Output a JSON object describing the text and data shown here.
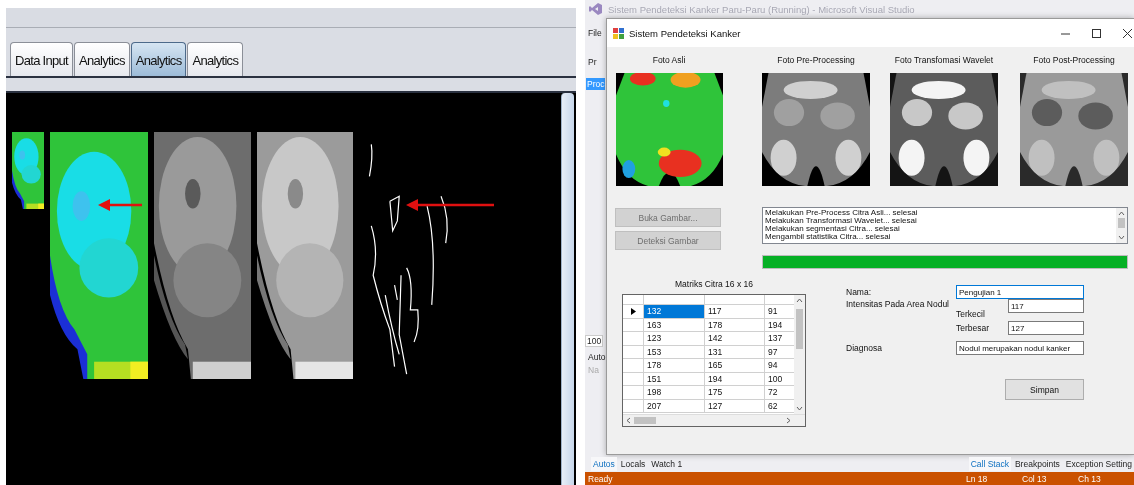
{
  "left_app": {
    "tabs": [
      {
        "label": "Data Input",
        "selected": false
      },
      {
        "label": "Analytics",
        "selected": false
      },
      {
        "label": "Analytics",
        "selected": true
      },
      {
        "label": "Analytics",
        "selected": false
      }
    ]
  },
  "ide": {
    "title": "Sistem Pendeteksi Kanker Paru-Paru (Running) - Microsoft Visual Studio",
    "side_fragments": [
      {
        "text": "File",
        "kind": "menu"
      },
      {
        "text": "Pr",
        "kind": "text"
      },
      {
        "text": "Proc",
        "kind": "header"
      },
      {
        "text": "100",
        "kind": "field"
      },
      {
        "text": "Auto",
        "kind": "text"
      },
      {
        "text": "Na",
        "kind": "dim"
      }
    ],
    "dialog": {
      "title": "Sistem Pendeteksi Kanker",
      "photos": [
        {
          "label": "Foto Asli"
        },
        {
          "label": "Foto Pre-Processing"
        },
        {
          "label": "Foto Transfomasi Wavelet"
        },
        {
          "label": "Foto Post-Processing"
        }
      ],
      "buttons": [
        {
          "label": "Buka Gambar...",
          "disabled": true
        },
        {
          "label": "Deteksi Gambar",
          "disabled": true
        }
      ],
      "log": [
        "Melakukan Pre-Process Citra Asli... selesai",
        "Melakukan Transformasi Wavelet... selesai",
        "Melakukan segmentasi Citra... selesai",
        "Mengambil statistika Citra... selesai"
      ],
      "progress": {
        "level": 1
      },
      "matrix": {
        "title": "Matriks Citra 16 x 16",
        "rows": [
          {
            "current": true,
            "cells": [
              {
                "text": "132",
                "selected": true
              },
              {
                "text": "117",
                "selected": false
              },
              {
                "text": "91",
                "selected": false
              }
            ]
          },
          {
            "current": false,
            "cells": [
              {
                "text": "163",
                "selected": false
              },
              {
                "text": "178",
                "selected": false
              },
              {
                "text": "194",
                "selected": false
              }
            ]
          },
          {
            "current": false,
            "cells": [
              {
                "text": "123",
                "selected": false
              },
              {
                "text": "142",
                "selected": false
              },
              {
                "text": "137",
                "selected": false
              }
            ]
          },
          {
            "current": false,
            "cells": [
              {
                "text": "153",
                "selected": false
              },
              {
                "text": "131",
                "selected": false
              },
              {
                "text": "97",
                "selected": false
              }
            ]
          },
          {
            "current": false,
            "cells": [
              {
                "text": "178",
                "selected": false
              },
              {
                "text": "165",
                "selected": false
              },
              {
                "text": "94",
                "selected": false
              }
            ]
          },
          {
            "current": false,
            "cells": [
              {
                "text": "151",
                "selected": false
              },
              {
                "text": "194",
                "selected": false
              },
              {
                "text": "100",
                "selected": false
              }
            ]
          },
          {
            "current": false,
            "cells": [
              {
                "text": "198",
                "selected": false
              },
              {
                "text": "175",
                "selected": false
              },
              {
                "text": "72",
                "selected": false
              }
            ]
          },
          {
            "current": false,
            "cells": [
              {
                "text": "207",
                "selected": false
              },
              {
                "text": "127",
                "selected": false
              },
              {
                "text": "62",
                "selected": false
              }
            ]
          }
        ]
      },
      "form": {
        "name": {
          "label": "Nama:",
          "value": "Pengujian 1",
          "focused": true
        },
        "intensity": {
          "label": "Intensitas Pada Area Nodul",
          "min": {
            "label": "Terkecil",
            "value": "117"
          },
          "max": {
            "label": "Terbesar",
            "value": "127"
          }
        },
        "diagnosis": {
          "label": "Diagnosa",
          "value": "Nodul merupakan nodul kanker"
        },
        "save_button": {
          "label": "Simpan"
        }
      }
    },
    "debug_tabs_left": [
      {
        "label": "Autos",
        "selected": true
      },
      {
        "label": "Locals",
        "selected": false
      },
      {
        "label": "Watch 1",
        "selected": false
      }
    ],
    "debug_tabs_right": [
      {
        "label": "Call Stack",
        "selected": true
      },
      {
        "label": "Breakpoints",
        "selected": false
      },
      {
        "label": "Exception Setting",
        "selected": false
      }
    ],
    "status_bar": {
      "items": [
        "Ready",
        "Ln 18",
        "Col 13",
        "Ch 13"
      ]
    }
  }
}
